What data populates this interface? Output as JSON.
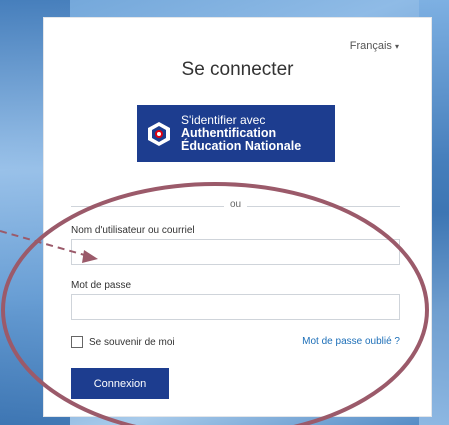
{
  "language_selector": "Français",
  "title": "Se connecter",
  "edu_button": {
    "line1": "S'identifier avec",
    "line2": "Authentification",
    "line3": "Éducation Nationale"
  },
  "divider_text": "ou",
  "username": {
    "label": "Nom d'utilisateur ou courriel",
    "value": ""
  },
  "password": {
    "label": "Mot de passe",
    "value": ""
  },
  "remember_me": {
    "label": "Se souvenir de moi",
    "checked": false
  },
  "forgot_password": "Mot de passe oublié ?",
  "login_button": "Connexion",
  "colors": {
    "brand": "#1d3d8f",
    "link": "#1d6fb8",
    "annotation": "#9b5a6a"
  }
}
